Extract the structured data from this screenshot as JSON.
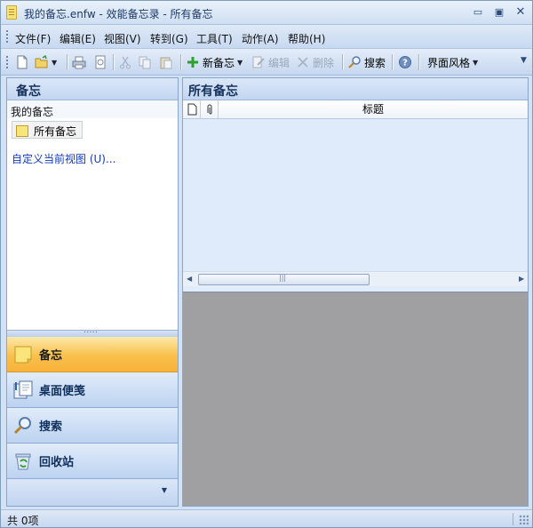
{
  "window": {
    "title": "我的备忘.enfw - 效能备忘录 - 所有备忘",
    "min_glyph": "▭",
    "max_glyph": "▣",
    "close_glyph": "✕"
  },
  "menu": {
    "items": [
      "文件(F)",
      "编辑(E)",
      "视图(V)",
      "转到(G)",
      "工具(T)",
      "动作(A)",
      "帮助(H)"
    ]
  },
  "toolbar": {
    "new_note": "新备忘",
    "edit": "编辑",
    "delete": "删除",
    "search": "搜索",
    "skin": "界面风格",
    "icons": [
      "new-file-icon",
      "open-folder-icon",
      "print-icon",
      "print-preview-icon",
      "cut-icon",
      "copy-icon",
      "paste-icon",
      "plus-icon",
      "edit-icon",
      "delete-icon",
      "search-icon",
      "help-icon"
    ],
    "accent_green": "#2f9e2f"
  },
  "left_pane": {
    "header": "备忘",
    "group_label": "我的备忘",
    "folder": "所有备忘",
    "customize_link": "自定义当前视图 (U)...",
    "nav": [
      {
        "label": "备忘",
        "icon": "sticky-note-icon",
        "active": true
      },
      {
        "label": "桌面便笺",
        "icon": "desktop-note-icon",
        "active": false
      },
      {
        "label": "搜索",
        "icon": "magnifier-icon",
        "active": false
      },
      {
        "label": "回收站",
        "icon": "recycle-bin-icon",
        "active": false
      }
    ],
    "active_color": "#f9c04b"
  },
  "right_pane": {
    "header": "所有备忘",
    "columns": [
      "",
      "",
      "标题"
    ],
    "column_icons": [
      "document-icon",
      "attachment-icon"
    ]
  },
  "status": {
    "text": "共 0项"
  }
}
